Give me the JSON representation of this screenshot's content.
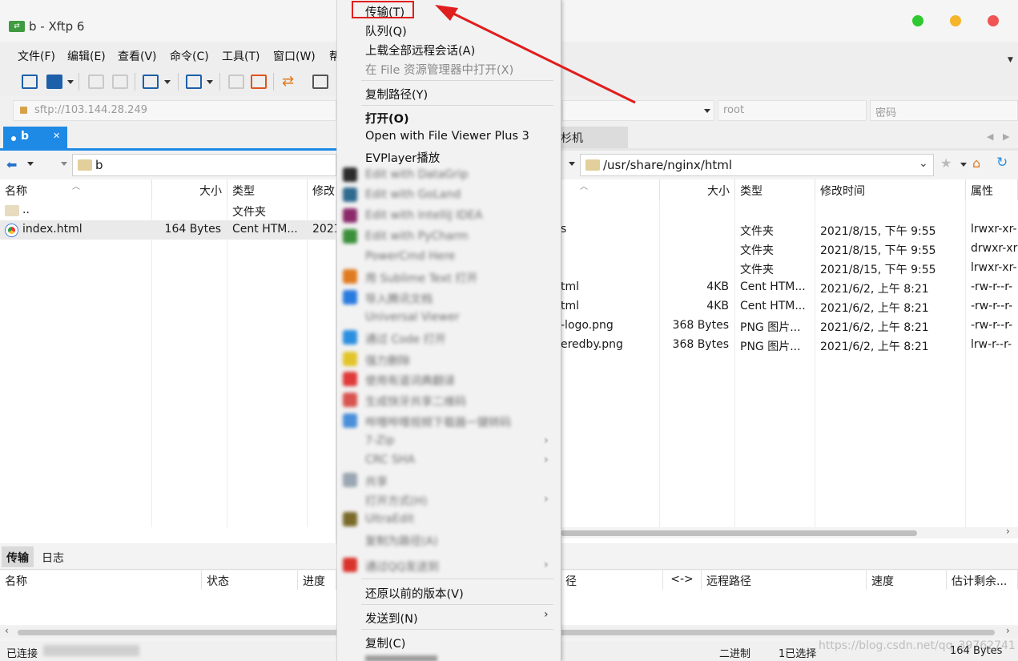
{
  "window": {
    "title": "b - Xftp 6",
    "traffic_light_colors": [
      "#2ec92e",
      "#f5b52a",
      "#f05454"
    ]
  },
  "menu": [
    "文件(F)",
    "编辑(E)",
    "查看(V)",
    "命令(C)",
    "工具(T)",
    "窗口(W)",
    "帮"
  ],
  "address": {
    "url": "sftp://103.144.28.249",
    "user_placeholder": "root",
    "password_placeholder": "密码"
  },
  "left": {
    "tab": "b",
    "path": "b",
    "columns": [
      "名称",
      "大小",
      "类型",
      "修改"
    ],
    "rows": [
      {
        "name": "..",
        "size": "",
        "type": "文件夹",
        "modified": ""
      },
      {
        "name": "index.html",
        "size": "164 Bytes",
        "type": "Cent HTM...",
        "modified": "2021"
      }
    ]
  },
  "right": {
    "tab": "杉机",
    "path": "/usr/share/nginx/html",
    "columns": [
      "大小",
      "类型",
      "修改时间",
      "属性"
    ],
    "rows": [
      {
        "name": "s",
        "size": "",
        "type": "文件夹",
        "modified": "2021/8/15, 下午 9:55",
        "attr": "lrwxr-xr-"
      },
      {
        "name": "",
        "size": "",
        "type": "文件夹",
        "modified": "2021/8/15, 下午 9:55",
        "attr": "drwxr-xr"
      },
      {
        "name": "",
        "size": "",
        "type": "文件夹",
        "modified": "2021/8/15, 下午 9:55",
        "attr": "lrwxr-xr-"
      },
      {
        "name": "tml",
        "size": "4KB",
        "type": "Cent HTM...",
        "modified": "2021/6/2, 上午 8:21",
        "attr": "-rw-r--r-"
      },
      {
        "name": "tml",
        "size": "4KB",
        "type": "Cent HTM...",
        "modified": "2021/6/2, 上午 8:21",
        "attr": "-rw-r--r-"
      },
      {
        "name": "-logo.png",
        "size": "368 Bytes",
        "type": "PNG 图片...",
        "modified": "2021/6/2, 上午 8:21",
        "attr": "-rw-r--r-"
      },
      {
        "name": "eredby.png",
        "size": "368 Bytes",
        "type": "PNG 图片...",
        "modified": "2021/6/2, 上午 8:21",
        "attr": "lrw-r--r-"
      }
    ]
  },
  "bottom": {
    "tabs": [
      "传输",
      "日志"
    ],
    "columns_left": [
      "名称",
      "状态",
      "进度"
    ],
    "columns_right": [
      "径",
      "<->",
      "远程路径",
      "速度",
      "估计剩余..."
    ]
  },
  "status": {
    "connected": "已连接",
    "mode": "二进制",
    "selected": "1已选择",
    "size": "164 Bytes",
    "watermark": "https://blog.csdn.net/qq_39762741"
  },
  "context_menu": {
    "items": [
      {
        "label": "传输(T)",
        "style": "normal"
      },
      {
        "label": "队列(Q)",
        "style": "normal"
      },
      {
        "label": "上载全部远程会话(A)",
        "style": "normal"
      },
      {
        "label": "在 File 资源管理器中打开(X)",
        "style": "disabled"
      },
      {
        "label": "复制路径(Y)",
        "style": "normal"
      },
      {
        "label": "打开(O)",
        "style": "bold"
      },
      {
        "label": "Open with File Viewer Plus 3",
        "style": "normal"
      },
      {
        "label": "EVPlayer播放",
        "style": "normal"
      },
      {
        "label": "Edit with DataGrip",
        "style": "blurred",
        "icon_color": "#2c2c2c"
      },
      {
        "label": "Edit with GoLand",
        "style": "blurred",
        "icon_color": "#2f6a8f"
      },
      {
        "label": "Edit with IntelliJ IDEA",
        "style": "blurred",
        "icon_color": "#8b2a6a"
      },
      {
        "label": "Edit with PyCharm",
        "style": "blurred",
        "icon_color": "#3b8f3b"
      },
      {
        "label": "PowerCmd Here",
        "style": "blurred",
        "icon_color": ""
      },
      {
        "label": "用 Sublime Text 打开",
        "style": "blurred",
        "icon_color": "#e07a1f"
      },
      {
        "label": "导入腾讯文档",
        "style": "blurred",
        "icon_color": "#2a7be0"
      },
      {
        "label": "Universal Viewer",
        "style": "blurred",
        "icon_color": ""
      },
      {
        "label": "通过 Code 打开",
        "style": "blurred",
        "icon_color": "#2b8fe0"
      },
      {
        "label": "强力删除",
        "style": "blurred",
        "icon_color": "#e2c42a"
      },
      {
        "label": "使用有道词典翻译",
        "style": "blurred",
        "icon_color": "#e03a3a"
      },
      {
        "label": "生成快牙共享二维码",
        "style": "blurred",
        "icon_color": "#d9534f"
      },
      {
        "label": "哔哩哔哩视频下载器一键转码",
        "style": "blurred",
        "icon_color": "#4a8fd9"
      },
      {
        "label": "7-Zip",
        "style": "blurred",
        "icon_color": "",
        "submenu": true
      },
      {
        "label": "CRC SHA",
        "style": "blurred",
        "icon_color": "",
        "submenu": true
      },
      {
        "label": "共享",
        "style": "blurred",
        "icon_color": "#9aa6b2"
      },
      {
        "label": "打开方式(H)",
        "style": "blurred",
        "icon_color": "",
        "submenu": true
      },
      {
        "label": "UltraEdit",
        "style": "blurred",
        "icon_color": "#7a6a2a"
      },
      {
        "label": "复制为路径(A)",
        "style": "blurred",
        "icon_color": ""
      },
      {
        "label": "通过QQ发送到",
        "style": "blurred",
        "icon_color": "#d9332b",
        "submenu": true
      },
      {
        "label": "还原以前的版本(V)",
        "style": "normal"
      },
      {
        "label": "发送到(N)",
        "style": "normal",
        "submenu": true
      },
      {
        "label": "复制(C)",
        "style": "normal"
      }
    ]
  },
  "annotation": {
    "color": "#e01e1e"
  }
}
